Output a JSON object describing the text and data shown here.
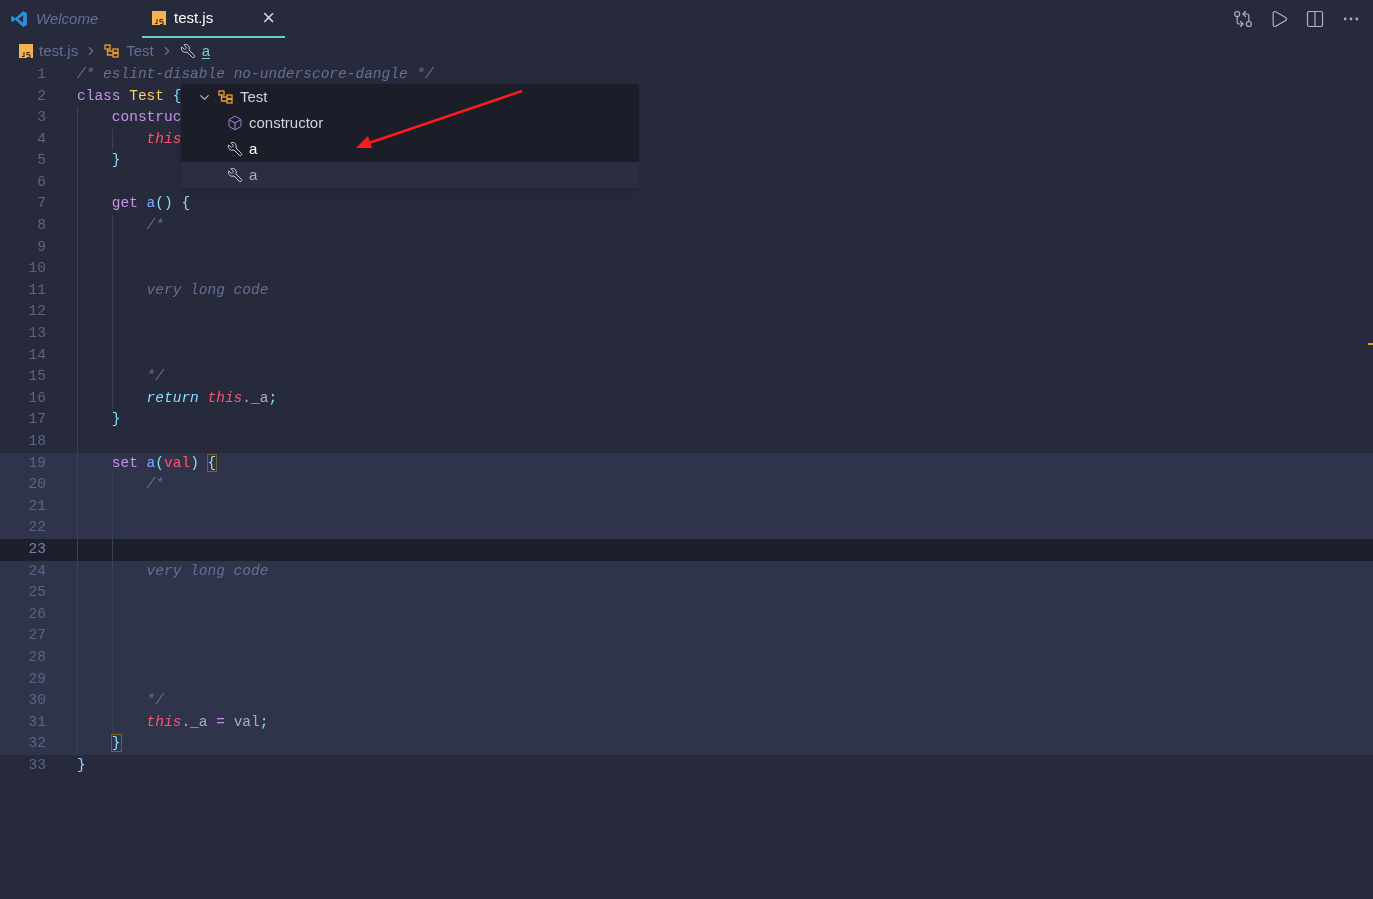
{
  "tabs": [
    {
      "label": "Welcome",
      "kind": "vscode",
      "preview": true,
      "selected": false,
      "closable": false
    },
    {
      "label": "test.js",
      "kind": "js",
      "preview": false,
      "selected": true,
      "closable": true,
      "close_glyph": "×"
    }
  ],
  "breadcrumbs": [
    {
      "label": "test.js",
      "kind": "js",
      "selected": false
    },
    {
      "label": "Test",
      "kind": "class",
      "selected": false
    },
    {
      "label": "a",
      "kind": "property",
      "selected": true
    }
  ],
  "outline_popup": {
    "items": [
      {
        "label": "Test",
        "kind": "class",
        "expanded": true,
        "selected": false,
        "children": [
          {
            "label": "constructor",
            "kind": "method",
            "selected": false,
            "focused": false
          },
          {
            "label": "a",
            "kind": "property",
            "selected": false,
            "focused": true
          },
          {
            "label": "a",
            "kind": "property",
            "selected": true,
            "focused": false
          }
        ]
      }
    ]
  },
  "code_lines": [
    {
      "number": "1",
      "highlighted": false,
      "current": false,
      "tokens": [
        {
          "text": "/* eslint-disable no-underscore-dangle */",
          "kind": "comment"
        }
      ]
    },
    {
      "number": "2",
      "highlighted": false,
      "current": false,
      "tokens": [
        {
          "text": "class ",
          "kind": "keyword"
        },
        {
          "text": "Test",
          "kind": "class"
        },
        {
          "text": " {",
          "kind": "brace"
        }
      ],
      "children": [
        {
          "number": "3",
          "highlighted": false,
          "current": false,
          "tokens": [
            {
              "text": "construc",
              "kind": "keyword"
            }
          ],
          "children": [
            {
              "number": "4",
              "highlighted": false,
              "current": false,
              "tokens": [
                {
                  "text": "this",
                  "kind": "this"
                }
              ]
            }
          ]
        },
        {
          "number": "5",
          "highlighted": false,
          "current": false,
          "tokens": [
            {
              "text": "}",
              "kind": "brace"
            }
          ]
        },
        {
          "number": "6",
          "highlighted": false,
          "current": false
        },
        {
          "number": "7",
          "highlighted": false,
          "current": false,
          "tokens": [
            {
              "text": "get ",
              "kind": "keyword"
            },
            {
              "text": "a",
              "kind": "function"
            },
            {
              "text": "() {",
              "kind": "brace"
            }
          ],
          "children": [
            {
              "number": "8",
              "highlighted": false,
              "current": false,
              "tokens": [
                {
                  "text": "/*",
                  "kind": "comment"
                }
              ]
            },
            {
              "number": "9",
              "highlighted": false,
              "current": false
            },
            {
              "number": "10",
              "highlighted": false,
              "current": false
            },
            {
              "number": "11",
              "highlighted": false,
              "current": false,
              "tokens": [
                {
                  "text": "very long code",
                  "kind": "comment"
                }
              ]
            },
            {
              "number": "12",
              "highlighted": false,
              "current": false
            },
            {
              "number": "13",
              "highlighted": false,
              "current": false
            },
            {
              "number": "14",
              "highlighted": false,
              "current": false
            },
            {
              "number": "15",
              "highlighted": false,
              "current": false,
              "tokens": [
                {
                  "text": "*/",
                  "kind": "comment"
                }
              ]
            },
            {
              "number": "16",
              "highlighted": false,
              "current": false,
              "tokens": [
                {
                  "text": "return ",
                  "kind": "control"
                },
                {
                  "text": "this",
                  "kind": "this"
                },
                {
                  "text": "._a",
                  "kind": "plain"
                },
                {
                  "text": ";",
                  "kind": "brace"
                }
              ]
            }
          ]
        },
        {
          "number": "17",
          "highlighted": false,
          "current": false,
          "tokens": [
            {
              "text": "}",
              "kind": "brace"
            }
          ]
        },
        {
          "number": "18",
          "highlighted": false,
          "current": false
        },
        {
          "number": "19",
          "highlighted": true,
          "current": false,
          "tokens": [
            {
              "text": "set ",
              "kind": "keyword"
            },
            {
              "text": "a",
              "kind": "function"
            },
            {
              "text": "(",
              "kind": "brace"
            },
            {
              "text": "val",
              "kind": "param"
            },
            {
              "text": ") ",
              "kind": "brace"
            },
            {
              "text": "{",
              "kind": "brace",
              "matched": true
            }
          ],
          "children": [
            {
              "number": "20",
              "highlighted": true,
              "current": false,
              "tokens": [
                {
                  "text": "/*",
                  "kind": "comment"
                }
              ]
            },
            {
              "number": "21",
              "highlighted": true,
              "current": false
            },
            {
              "number": "22",
              "highlighted": true,
              "current": false
            },
            {
              "number": "23",
              "highlighted": true,
              "current": true
            },
            {
              "number": "24",
              "highlighted": true,
              "current": false,
              "tokens": [
                {
                  "text": "very long code",
                  "kind": "comment"
                }
              ]
            },
            {
              "number": "25",
              "highlighted": true,
              "current": false
            },
            {
              "number": "26",
              "highlighted": true,
              "current": false
            },
            {
              "number": "27",
              "highlighted": true,
              "current": false
            },
            {
              "number": "28",
              "highlighted": true,
              "current": false
            },
            {
              "number": "29",
              "highlighted": true,
              "current": false
            },
            {
              "number": "30",
              "highlighted": true,
              "current": false,
              "tokens": [
                {
                  "text": "*/",
                  "kind": "comment"
                }
              ]
            },
            {
              "number": "31",
              "highlighted": true,
              "current": false,
              "tokens": [
                {
                  "text": "this",
                  "kind": "this"
                },
                {
                  "text": "._a ",
                  "kind": "plain"
                },
                {
                  "text": "= ",
                  "kind": "keyword"
                },
                {
                  "text": "val",
                  "kind": "plain"
                },
                {
                  "text": ";",
                  "kind": "brace"
                }
              ]
            }
          ]
        },
        {
          "number": "32",
          "highlighted": true,
          "current": false,
          "tokens": [
            {
              "text": "}",
              "kind": "brace",
              "matched": true
            }
          ]
        }
      ]
    },
    {
      "number": "33",
      "highlighted": false,
      "current": false,
      "tokens": [
        {
          "text": "}",
          "kind": "brace"
        }
      ]
    }
  ]
}
